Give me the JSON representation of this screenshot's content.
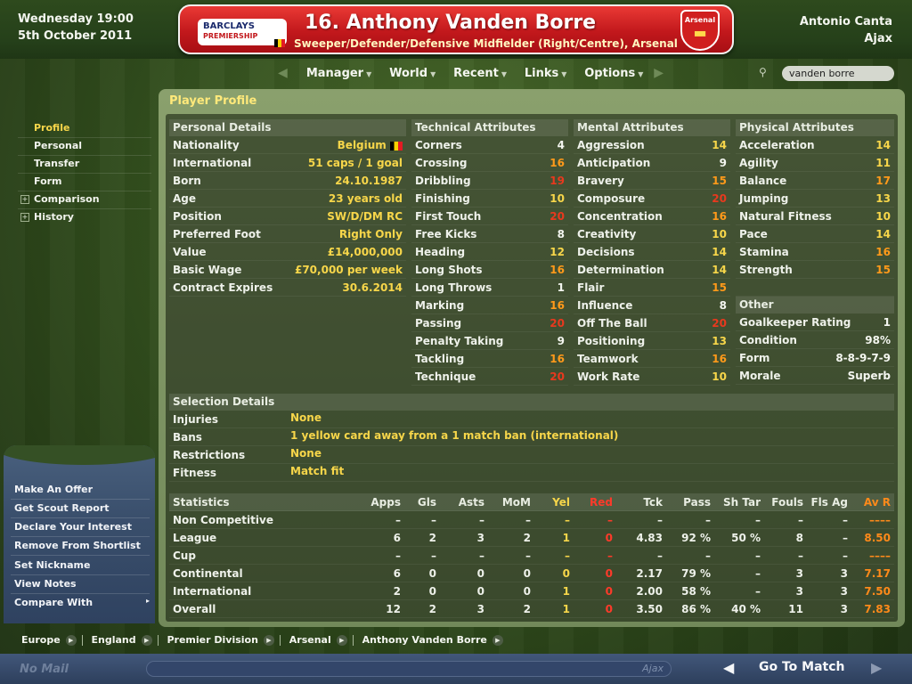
{
  "header": {
    "date_line1": "Wednesday 19:00",
    "date_line2": "5th October 2011",
    "manager_name": "Antonio Canta",
    "manager_club": "Ajax",
    "league_logo_line1": "BARCLAYS",
    "league_logo_line2": "PREMIERSHIP",
    "player_title": "16. Anthony Vanden Borre",
    "player_subtitle": "Sweeper/Defender/Defensive Midfielder (Right/Centre), Arsenal",
    "club_crest_label": "Arsenal"
  },
  "nav": {
    "items": [
      "Manager",
      "World",
      "Recent",
      "Links",
      "Options"
    ],
    "search_value": "vanden borre"
  },
  "sidebar": {
    "items": [
      "Profile",
      "Personal",
      "Transfer",
      "Form",
      "Comparison",
      "History"
    ],
    "active": "Profile"
  },
  "actions": [
    "Make An Offer",
    "Get Scout Report",
    "Declare Your Interest",
    "Remove From Shortlist",
    "Set Nickname",
    "View Notes",
    "Compare With"
  ],
  "main": {
    "title": "Player Profile",
    "personal": {
      "heading": "Personal Details",
      "rows": [
        {
          "label": "Nationality",
          "value": "Belgium"
        },
        {
          "label": "International",
          "value": "51 caps / 1 goal"
        },
        {
          "label": "Born",
          "value": "24.10.1987"
        },
        {
          "label": "Age",
          "value": "23 years old"
        },
        {
          "label": "Position",
          "value": "SW/D/DM RC"
        },
        {
          "label": "Preferred Foot",
          "value": "Right Only"
        },
        {
          "label": "Value",
          "value": "£14,000,000"
        },
        {
          "label": "Basic Wage",
          "value": "£70,000 per week"
        },
        {
          "label": "Contract Expires",
          "value": "30.6.2014"
        }
      ]
    },
    "technical": {
      "heading": "Technical Attributes",
      "rows": [
        {
          "label": "Corners",
          "value": "4"
        },
        {
          "label": "Crossing",
          "value": "16"
        },
        {
          "label": "Dribbling",
          "value": "19"
        },
        {
          "label": "Finishing",
          "value": "10"
        },
        {
          "label": "First Touch",
          "value": "20"
        },
        {
          "label": "Free Kicks",
          "value": "8"
        },
        {
          "label": "Heading",
          "value": "12"
        },
        {
          "label": "Long Shots",
          "value": "16"
        },
        {
          "label": "Long Throws",
          "value": "1"
        },
        {
          "label": "Marking",
          "value": "16"
        },
        {
          "label": "Passing",
          "value": "20"
        },
        {
          "label": "Penalty Taking",
          "value": "9"
        },
        {
          "label": "Tackling",
          "value": "16"
        },
        {
          "label": "Technique",
          "value": "20"
        }
      ]
    },
    "mental": {
      "heading": "Mental Attributes",
      "rows": [
        {
          "label": "Aggression",
          "value": "14"
        },
        {
          "label": "Anticipation",
          "value": "9"
        },
        {
          "label": "Bravery",
          "value": "15"
        },
        {
          "label": "Composure",
          "value": "20"
        },
        {
          "label": "Concentration",
          "value": "16"
        },
        {
          "label": "Creativity",
          "value": "10"
        },
        {
          "label": "Decisions",
          "value": "14"
        },
        {
          "label": "Determination",
          "value": "14"
        },
        {
          "label": "Flair",
          "value": "15"
        },
        {
          "label": "Influence",
          "value": "8"
        },
        {
          "label": "Off The Ball",
          "value": "20"
        },
        {
          "label": "Positioning",
          "value": "13"
        },
        {
          "label": "Teamwork",
          "value": "16"
        },
        {
          "label": "Work Rate",
          "value": "10"
        }
      ]
    },
    "physical": {
      "heading": "Physical Attributes",
      "rows": [
        {
          "label": "Acceleration",
          "value": "14"
        },
        {
          "label": "Agility",
          "value": "11"
        },
        {
          "label": "Balance",
          "value": "17"
        },
        {
          "label": "Jumping",
          "value": "13"
        },
        {
          "label": "Natural Fitness",
          "value": "10"
        },
        {
          "label": "Pace",
          "value": "14"
        },
        {
          "label": "Stamina",
          "value": "16"
        },
        {
          "label": "Strength",
          "value": "15"
        }
      ]
    },
    "other": {
      "heading": "Other",
      "rows": [
        {
          "label": "Goalkeeper Rating",
          "value": "1"
        },
        {
          "label": "Condition",
          "value": "98%"
        },
        {
          "label": "Form",
          "value": "8-8-9-7-9"
        },
        {
          "label": "Morale",
          "value": "Superb"
        }
      ]
    },
    "selection": {
      "heading": "Selection Details",
      "rows": [
        {
          "label": "Injuries",
          "value": "None"
        },
        {
          "label": "Bans",
          "value": "1 yellow card away from a 1 match ban (international)"
        },
        {
          "label": "Restrictions",
          "value": "None"
        },
        {
          "label": "Fitness",
          "value": "Match fit"
        }
      ]
    },
    "statistics": {
      "columns": [
        "Statistics",
        "Apps",
        "Gls",
        "Asts",
        "MoM",
        "Yel",
        "Red",
        "Tck",
        "Pass",
        "Sh Tar",
        "Fouls",
        "Fls Ag",
        "Av R"
      ],
      "rows": [
        [
          "Non Competitive",
          "–",
          "–",
          "–",
          "–",
          "–",
          "–",
          "–",
          "–",
          "–",
          "–",
          "–",
          "––––"
        ],
        [
          "League",
          "6",
          "2",
          "3",
          "2",
          "1",
          "0",
          "4.83",
          "92 %",
          "50 %",
          "8",
          "–",
          "8.50"
        ],
        [
          "Cup",
          "–",
          "–",
          "–",
          "–",
          "–",
          "–",
          "–",
          "–",
          "–",
          "–",
          "–",
          "––––"
        ],
        [
          "Continental",
          "6",
          "0",
          "0",
          "0",
          "0",
          "0",
          "2.17",
          "79 %",
          "–",
          "3",
          "3",
          "7.17"
        ],
        [
          "International",
          "2",
          "0",
          "0",
          "0",
          "1",
          "0",
          "2.00",
          "58 %",
          "–",
          "3",
          "3",
          "7.50"
        ],
        [
          "Overall",
          "12",
          "2",
          "3",
          "2",
          "1",
          "0",
          "3.50",
          "86 %",
          "40 %",
          "11",
          "3",
          "7.83"
        ]
      ]
    }
  },
  "breadcrumb": [
    "Europe",
    "England",
    "Premier Division",
    "Arsenal",
    "Anthony Vanden Borre"
  ],
  "bottom": {
    "mail": "No Mail",
    "progress_label": "Ajax",
    "go_to_match": "Go To Match"
  }
}
